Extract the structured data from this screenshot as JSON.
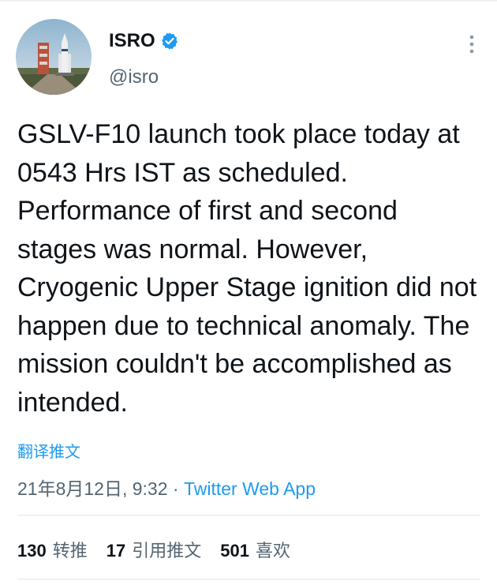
{
  "account": {
    "display_name": "ISRO",
    "handle": "@isro"
  },
  "icons": {
    "verified": "verified-badge-icon",
    "more": "more-vertical-icon"
  },
  "tweet": {
    "text": "GSLV-F10 launch took place today at 0543 Hrs IST as scheduled. Performance of first and second stages was normal. However, Cryogenic Upper Stage ignition did not happen due to technical anomaly. The mission couldn't be accomplished as intended.",
    "translate_label": "翻译推文",
    "timestamp": "21年8月12日, 9:32",
    "separator": "·",
    "source": "Twitter Web App"
  },
  "stats": {
    "retweets": {
      "count": "130",
      "label": "转推"
    },
    "quotes": {
      "count": "17",
      "label": "引用推文"
    },
    "likes": {
      "count": "501",
      "label": "喜欢"
    }
  },
  "colors": {
    "accent": "#1d9bf0",
    "text": "#0f1419",
    "secondary": "#536471",
    "divider": "#e1e6ea"
  }
}
